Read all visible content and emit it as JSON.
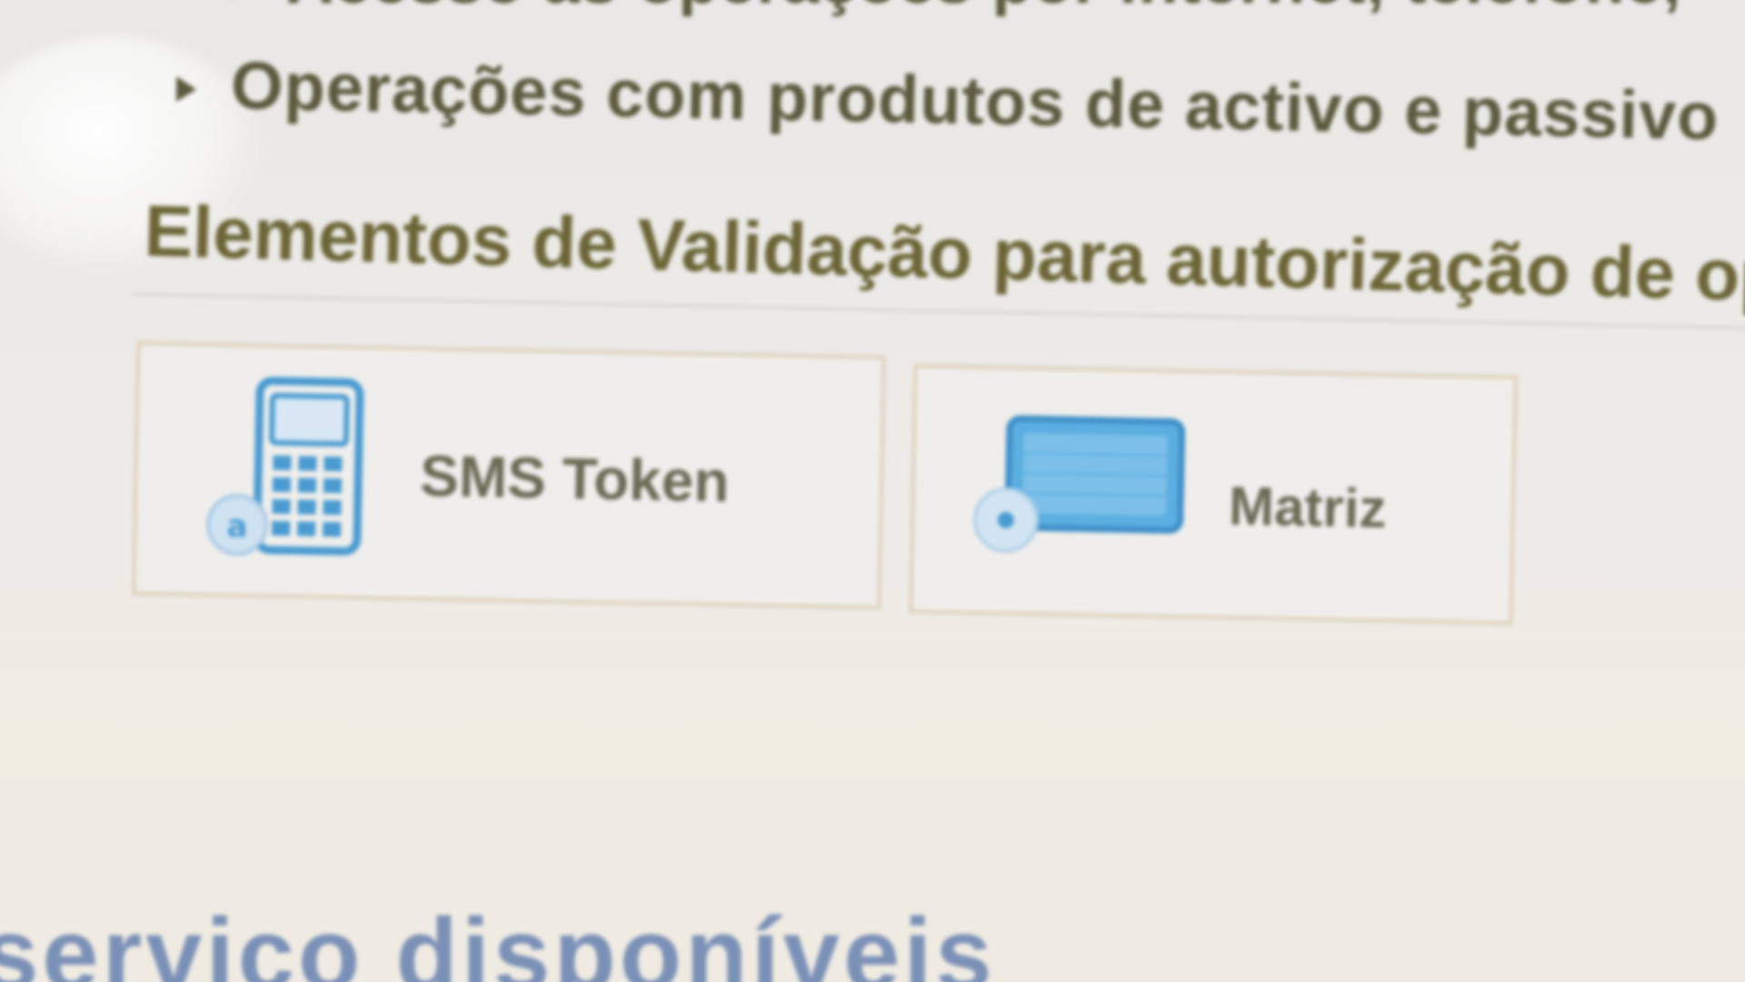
{
  "content": {
    "bullets": [
      "Acesso às operações por internet, telefone,",
      "Operações com produtos de activo e passivo"
    ],
    "validation_heading": "Elementos de Validação para autorização de op",
    "validation_options": [
      {
        "label": "SMS Token",
        "icon": "mobile-phone-icon"
      },
      {
        "label": "Matriz",
        "icon": "matrix-card-icon"
      }
    ],
    "service_heading": "serviço disponíveis"
  },
  "colors": {
    "background": "#eceae6",
    "body_text": "#5b5a3e",
    "heading_text": "#6b6536",
    "card_border": "#e0d4c2",
    "icon_blue": "#4a9bd1",
    "link_blue": "#7a90b6"
  }
}
